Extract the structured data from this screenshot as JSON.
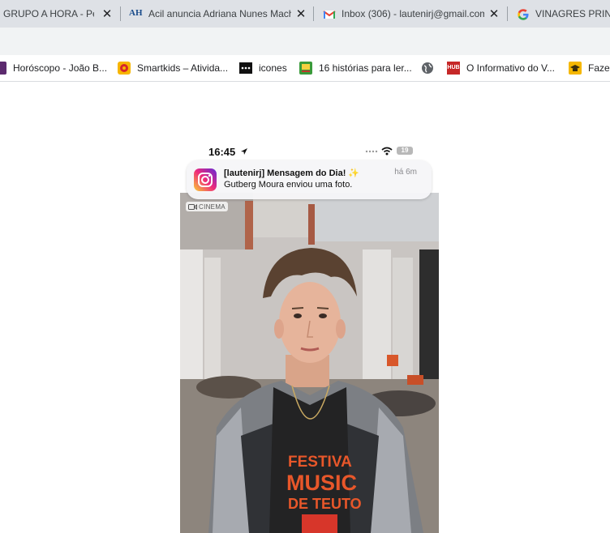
{
  "tabs": [
    {
      "title": "GRUPO A HORA - Pesquisa Google",
      "close": "✕",
      "favicon": "none"
    },
    {
      "title": "Acil anuncia Adriana Nunes Machado",
      "close": "✕",
      "favicon": "ah-logo-icon",
      "favicon_text": "AH"
    },
    {
      "title": "Inbox (306) - lautenirj@gmail.com",
      "close": "✕",
      "favicon": "gmail-icon"
    },
    {
      "title": "VINAGRES PRINZ",
      "favicon": "google-icon"
    }
  ],
  "bookmarks": [
    {
      "label": "Horóscopo - João B...",
      "icon": "horoscope-icon"
    },
    {
      "label": "Smartkids – Ativida...",
      "icon": "smartkids-icon"
    },
    {
      "label": "icones",
      "icon": "dots-icon"
    },
    {
      "label": "16 histórias para ler...",
      "icon": "book-icon"
    },
    {
      "label": "",
      "icon": "globe-icon"
    },
    {
      "label": "O Informativo do V...",
      "icon": "hub-icon",
      "icon_text": "HUB"
    },
    {
      "label": "Fazer",
      "icon": "graduation-icon"
    }
  ],
  "phone": {
    "status_time": "16:45",
    "battery": "19",
    "notification": {
      "title": "[lautenirj] Mensagem do Dia! ✨",
      "body": "Gutberg Moura enviou uma foto.",
      "time": "há 6m",
      "app_icon": "instagram-icon"
    },
    "cinema_badge": "CINEMA",
    "shirt_text": [
      "FESTIVA",
      "MUSIC",
      "DE TEUTO"
    ]
  },
  "colors": {
    "tabstrip_bg": "#dee1e6",
    "toolbar_bg": "#f1f3f4",
    "instagram_gradient": [
      "#f9ce34",
      "#ee2a7b",
      "#6228d7"
    ],
    "shirt_orange": "#e8572a"
  }
}
